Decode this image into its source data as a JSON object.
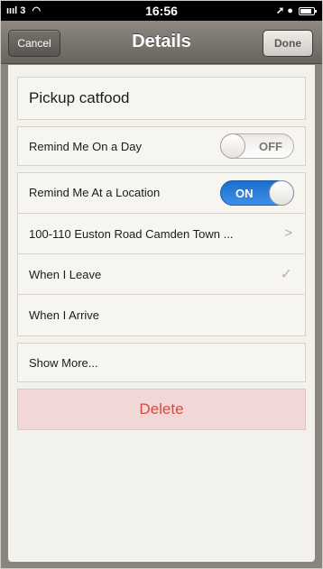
{
  "status_bar": {
    "carrier": "3",
    "time": "16:56",
    "right_icons": "location-arrow-icon alarm-icon battery-icon"
  },
  "nav": {
    "title": "Details",
    "cancel_label": "Cancel",
    "done_label": "Done"
  },
  "reminder": {
    "title": "Pickup catfood",
    "remind_on_day": {
      "label": "Remind Me On a Day",
      "state": "OFF"
    },
    "remind_at_location": {
      "label": "Remind Me At a Location",
      "state": "ON"
    },
    "location_address": "100-110 Euston Road Camden Town ...",
    "when_leave": "When I Leave",
    "when_arrive": "When I Arrive",
    "show_more": "Show More...",
    "delete": "Delete"
  },
  "colors": {
    "switch_on": "#2a7ede",
    "delete_text": "#d64a44",
    "delete_bg": "#f1d8d6"
  }
}
